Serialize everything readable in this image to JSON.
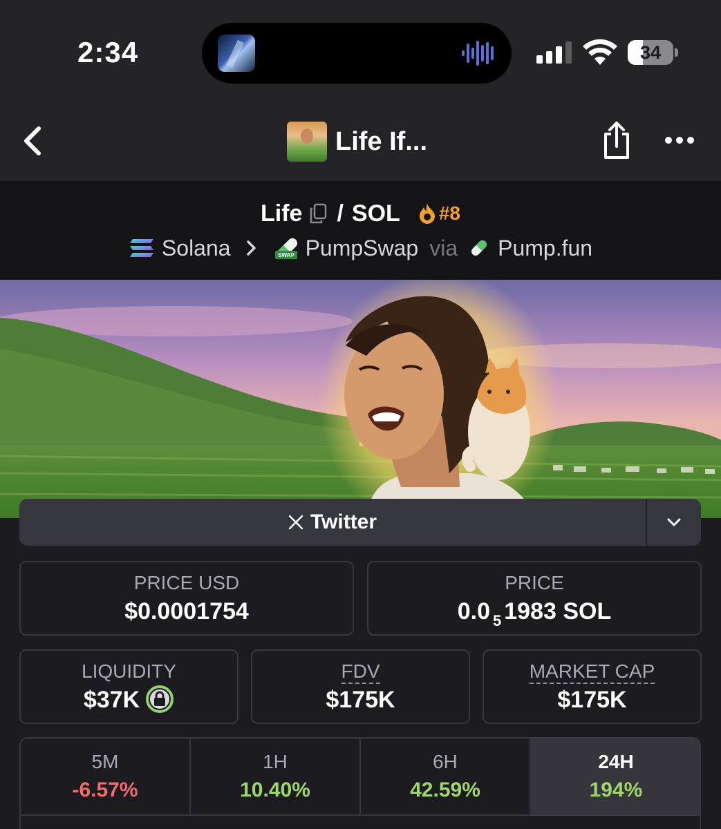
{
  "status_bar": {
    "time": "2:34",
    "battery": "34",
    "battery_level": 0.34,
    "icons": [
      "signal-icon",
      "wifi-icon",
      "battery-icon"
    ]
  },
  "nav": {
    "title": "Life If...",
    "icons": [
      "back-icon",
      "share-icon",
      "more-icon"
    ]
  },
  "pair": {
    "base": "Life",
    "separator": "/",
    "quote": "SOL",
    "rank": "#8",
    "chain": "Solana",
    "dex": "PumpSwap",
    "via": "via",
    "launchpad": "Pump.fun"
  },
  "links": {
    "twitter_label": "Twitter"
  },
  "stats": {
    "price_usd_label": "PRICE USD",
    "price_usd": "$0.0001754",
    "price_label": "PRICE",
    "price_prefix": "0.0",
    "price_zero_count": "5",
    "price_suffix": "1983 SOL",
    "liquidity_label": "LIQUIDITY",
    "liquidity": "$37K",
    "fdv_label": "FDV",
    "fdv": "$175K",
    "mcap_label": "MARKET CAP",
    "mcap": "$175K"
  },
  "changes": [
    {
      "period": "5M",
      "pct": "-6.57%"
    },
    {
      "period": "1H",
      "pct": "10.40%"
    },
    {
      "period": "6H",
      "pct": "42.59%"
    },
    {
      "period": "24H",
      "pct": "194%"
    }
  ],
  "colors": {
    "positive": "#9fd66a",
    "negative": "#f16d6d",
    "accent": "#f2a02a",
    "lock_green": "#8fd36a"
  }
}
